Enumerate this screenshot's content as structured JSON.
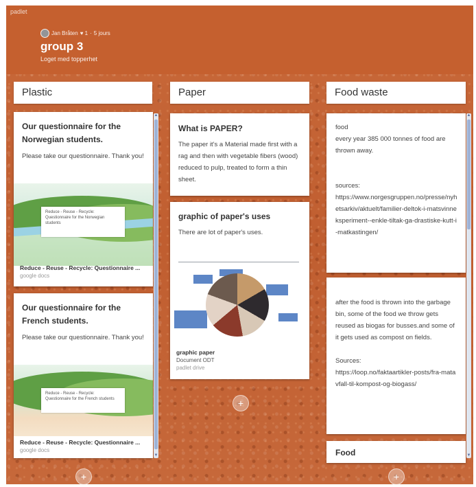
{
  "brand": "padlet",
  "header": {
    "author": "Jan Bråten",
    "likes": "♥ 1",
    "separator": "·",
    "time": "5 jours",
    "title": "group 3",
    "subtitle": "Loget med topperhet"
  },
  "columns": [
    {
      "title": "Plastic",
      "cards": [
        {
          "title": "Our questionnaire for the Norwegian students.",
          "body": "Please take our questionnaire. Thank you!",
          "preview_text": "Reduce - Reuse - Recycle: Questionnaire for the Norwegian students",
          "attachment_title": "Reduce - Reuse - Recycle: Questionnaire ...",
          "attachment_source": "google docs"
        },
        {
          "title": "Our questionnaire for the French students.",
          "body": "Please take our questionnaire. Thank you!",
          "preview_text": "Reduce - Reuse - Recycle: Questionnaire for the French students",
          "attachment_title": "Reduce - Reuse - Recycle: Questionnaire ...",
          "attachment_source": "google docs"
        }
      ]
    },
    {
      "title": "Paper",
      "cards": [
        {
          "title": "What is PAPER?",
          "body": "The paper it's a Material made first with a rag and then with vegetable fibers (wood) reduced to pulp, treated to form a thin sheet."
        },
        {
          "title": "graphic of paper's uses",
          "body": "There are lot of paper's uses.",
          "attachment_title": "graphic paper",
          "attachment_type": "Document ODT",
          "attachment_source": "padlet drive"
        }
      ]
    },
    {
      "title": "Food waste",
      "cards": [
        {
          "line1": "food",
          "line2": "every year 385 000 tonnes of food are thrown away.",
          "sources_label": "sources:",
          "link": "https://www.norgesgruppen.no/presse/nyhetsarkiv/aktuelt/familier-deltok-i-matsvinneksperiment--enkle-tiltak-ga-drastiske-kutt-i-matkastingen/"
        },
        {
          "body": "after the food is thrown into the garbage bin, some of the food we throw gets reused as biogas for busses.and some of it gets used as compost on fields.",
          "sources_label": "Sources:",
          "link": "https://loop.no/faktaartikler-posts/fra-matavfall-til-kompost-og-biogass/"
        },
        {
          "title": "Food"
        }
      ]
    }
  ],
  "add_label": "+",
  "scroll_up": "▲",
  "scroll_down": "▼",
  "colors": {
    "header": "#c5602f",
    "link": "#d63a86",
    "scroll_thumb": "#9fb3d6"
  }
}
